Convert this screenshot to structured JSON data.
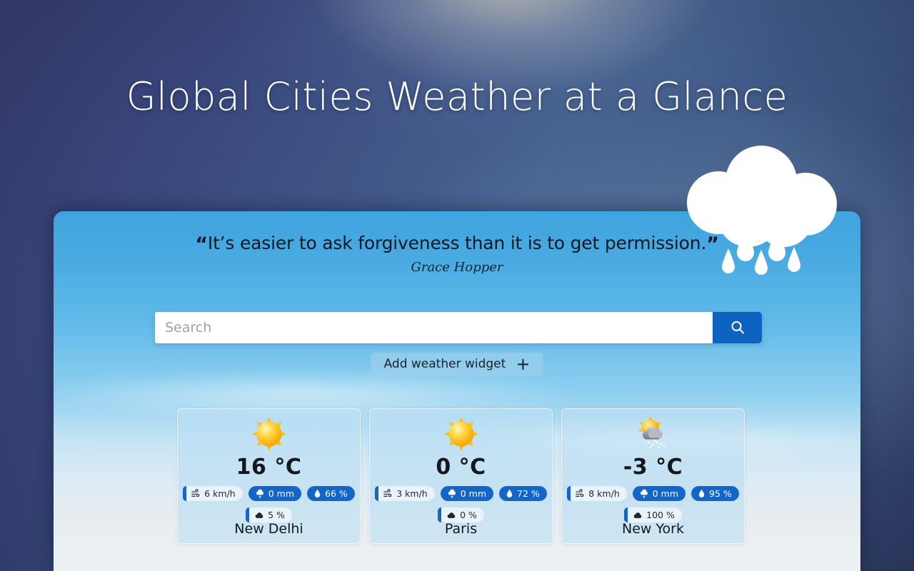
{
  "page": {
    "title": "Global Cities Weather at a Glance"
  },
  "quote": {
    "open_mark": "“",
    "close_mark": "”",
    "text": "It’s easier to ask forgiveness than it is to get permission.",
    "author": "Grace Hopper"
  },
  "search": {
    "value": "",
    "placeholder": "Search",
    "icon": "search-icon",
    "button_label": ""
  },
  "add_widget": {
    "label": "Add weather widget",
    "plus": "+"
  },
  "colors": {
    "accent_blue": "#1565c9",
    "button_blue": "#0e62c0",
    "panel_sky": "#4aabe2",
    "pill_light": "#eef5fa"
  },
  "cards": [
    {
      "city": "New Delhi",
      "temperature": "16 °C",
      "condition_icon": "sun-icon",
      "metrics": [
        {
          "name": "wind",
          "icon": "wind-icon",
          "value": "6 km/h",
          "style": "light"
        },
        {
          "name": "precipitation",
          "icon": "rain-drop-cloud-icon",
          "value": "0 mm",
          "style": "solid"
        },
        {
          "name": "humidity",
          "icon": "humidity-drop-icon",
          "value": "66 %",
          "style": "solid"
        },
        {
          "name": "cloud-cover",
          "icon": "cloud-icon",
          "value": "5 %",
          "style": "light"
        }
      ]
    },
    {
      "city": "Paris",
      "temperature": "0 °C",
      "condition_icon": "sun-icon",
      "metrics": [
        {
          "name": "wind",
          "icon": "wind-icon",
          "value": "3 km/h",
          "style": "light"
        },
        {
          "name": "precipitation",
          "icon": "rain-drop-cloud-icon",
          "value": "0 mm",
          "style": "solid"
        },
        {
          "name": "humidity",
          "icon": "humidity-drop-icon",
          "value": "72 %",
          "style": "solid"
        },
        {
          "name": "cloud-cover",
          "icon": "cloud-icon",
          "value": "0 %",
          "style": "light"
        }
      ]
    },
    {
      "city": "New York",
      "temperature": "-3 °C",
      "condition_icon": "sun-behind-snow-cloud-icon",
      "metrics": [
        {
          "name": "wind",
          "icon": "wind-icon",
          "value": "8 km/h",
          "style": "light"
        },
        {
          "name": "precipitation",
          "icon": "rain-drop-cloud-icon",
          "value": "0 mm",
          "style": "solid"
        },
        {
          "name": "humidity",
          "icon": "humidity-drop-icon",
          "value": "95 %",
          "style": "solid"
        },
        {
          "name": "cloud-cover",
          "icon": "cloud-icon",
          "value": "100 %",
          "style": "light"
        }
      ]
    }
  ],
  "decoration": {
    "cloud_icon": "rain-cloud-icon"
  }
}
